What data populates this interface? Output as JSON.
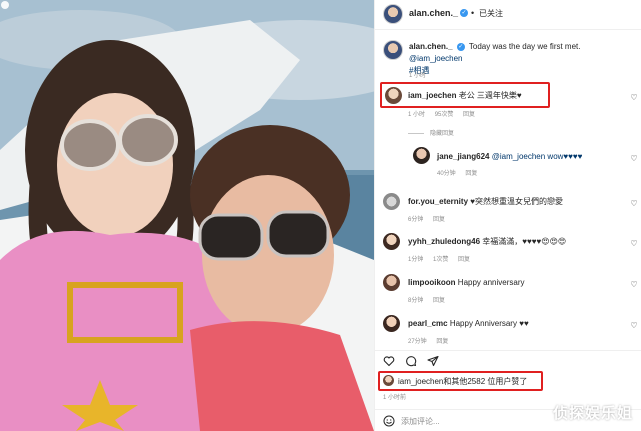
{
  "header": {
    "username": "alan.chen._",
    "verified_icon": "verified-badge-icon",
    "separator": "•",
    "follow_status": "已关注"
  },
  "caption": {
    "username": "alan.chen._",
    "text": "Today was the day we first met.",
    "mention": "@iam_joechen",
    "hashtag": "#相遇",
    "time": "1 小时"
  },
  "comments": [
    {
      "username": "iam_joechen",
      "text": "老公 三週年快樂♥",
      "time": "1 小时",
      "likes": "95次赞",
      "reply": "回复",
      "hidden_replies": "隐藏回复"
    },
    {
      "username": "jane_jiang624",
      "text": "@iam_joechen wow♥♥♥♥",
      "time": "40分钟",
      "reply": "回复"
    },
    {
      "username": "for.you_eternity",
      "text": "♥突然想重溫女兒們的戀愛",
      "time": "6分钟",
      "reply": "回复"
    },
    {
      "username": "yyhh_zhuledong46",
      "text": "幸福滿滿，♥♥♥♥😍😍😍",
      "time": "1分钟",
      "likes": "1次赞",
      "reply": "回复"
    },
    {
      "username": "limpooikoon",
      "text": "Happy anniversary",
      "time": "8分钟",
      "reply": "回复"
    },
    {
      "username": "pearl_cmc",
      "text": "Happy Anniversary ♥♥",
      "time": "27分钟",
      "reply": "回复"
    }
  ],
  "likes": {
    "text": "iam_joechen和其他2582 位用户赞了"
  },
  "post_time": "1 小时前",
  "add_comment": {
    "placeholder": "添加评论..."
  },
  "icons": {
    "like": "heart-outline-icon",
    "comment": "comment-bubble-icon",
    "share": "paper-plane-icon",
    "emoji": "smile-icon"
  },
  "watermark": "侦探娱乐姐",
  "colors": {
    "highlight": "#e02020",
    "link": "#00376b",
    "verified": "#3897f0",
    "muted": "#8e8e8e"
  }
}
